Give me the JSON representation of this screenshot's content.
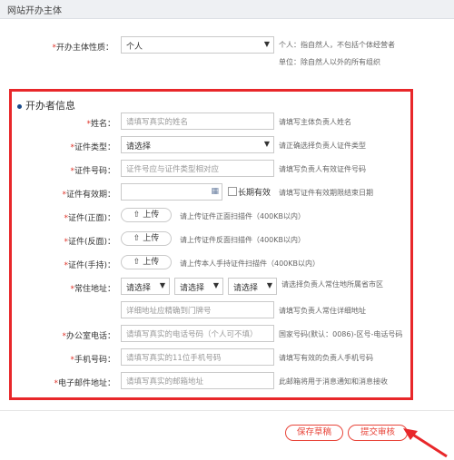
{
  "section": {
    "title": "网站开办主体"
  },
  "entity": {
    "label": "开办主体性质：",
    "value": "个人",
    "hint_line1": "个人：指自然人，不包括个体经营者",
    "hint_line2": "单位：除自然人以外的所有组织"
  },
  "operator": {
    "title": "开办者信息",
    "fields": {
      "name": {
        "label": "姓名：",
        "placeholder": "请填写真实的姓名",
        "hint": "请填写主体负责人姓名"
      },
      "id_type": {
        "label": "证件类型：",
        "value": "请选择",
        "hint": "请正确选择负责人证件类型"
      },
      "id_number": {
        "label": "证件号码：",
        "placeholder": "证件号应与证件类型相对应",
        "hint": "请填写负责人有效证件号码"
      },
      "id_expiry": {
        "label": "证件有效期：",
        "checkbox_label": "长期有效",
        "hint": "请填写证件有效期限结束日期"
      },
      "id_front": {
        "label": "证件(正面)：",
        "button": "上传",
        "hint": "请上传证件正面扫描件（400KB以内）"
      },
      "id_back": {
        "label": "证件(反面)：",
        "button": "上传",
        "hint": "请上传证件反面扫描件（400KB以内）"
      },
      "id_hold": {
        "label": "证件(手持)：",
        "button": "上传",
        "hint": "请上传本人手持证件扫描件（400KB以内）"
      },
      "address": {
        "label": "常住地址：",
        "province": "请选择",
        "city": "请选择",
        "district": "请选择",
        "region_hint": "请选择负责人常住地所属省市区",
        "detail_placeholder": "详细地址应精确到门牌号",
        "detail_hint": "请填写负责人常住详细地址"
      },
      "office_phone": {
        "label": "办公室电话：",
        "placeholder": "请填写真实的电话号码（个人可不填）",
        "hint": "国家号码(默认：0086)-区号-电话号码"
      },
      "mobile": {
        "label": "手机号码：",
        "placeholder": "请填写真实的11位手机号码",
        "hint": "请填写有效的负责人手机号码"
      },
      "email": {
        "label": "电子邮件地址：",
        "placeholder": "请填写真实的邮箱地址",
        "hint": "此邮箱将用于消息通知和消息接收"
      }
    }
  },
  "actions": {
    "save": "保存草稿",
    "submit": "提交审核"
  },
  "icons": {
    "upload": "upload-icon",
    "calendar": "calendar-icon",
    "dropdown": "chevron-down-icon"
  },
  "colors": {
    "accent": "#e8453a",
    "highlight": "#e8272a",
    "required": "#e0352b"
  }
}
